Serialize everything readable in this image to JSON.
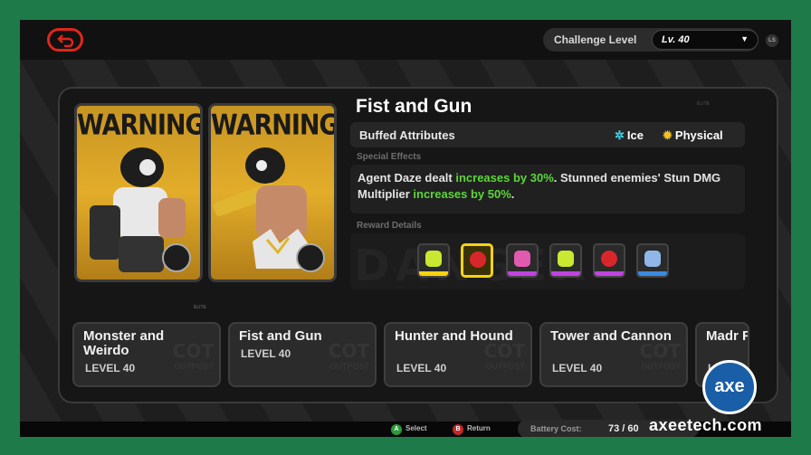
{
  "challenge": {
    "label": "Challenge Level",
    "level": "Lv. 40",
    "stick_hint": "LS"
  },
  "enemy_cards": [
    {
      "warning": "WARNING"
    },
    {
      "warning": "WARNING"
    }
  ],
  "elite_mark": "ELITE",
  "detail": {
    "title": "Fist and Gun",
    "buffed_label": "Buffed Attributes",
    "attributes": [
      {
        "name": "Ice",
        "icon": "ice-icon",
        "color": "#3fd6e8"
      },
      {
        "name": "Physical",
        "icon": "physical-icon",
        "color": "#f2c21c"
      }
    ],
    "special_label": "Special Effects",
    "special": {
      "p1": "Agent Daze dealt ",
      "h1": "increases by 30%",
      "p2": ". Stunned enemies' Stun DMG Multiplier ",
      "h2": "increases by 50%",
      "p3": "."
    },
    "reward_label": "Reward Details",
    "rewards": [
      {
        "icon": "w-engine-material-icon",
        "color": "#f5d312",
        "selected": false
      },
      {
        "icon": "drive-disc-icon",
        "color": "#f5d312",
        "selected": true
      },
      {
        "icon": "drive-disc-icon",
        "color": "#c044e0",
        "selected": false
      },
      {
        "icon": "w-engine-material-icon",
        "color": "#c044e0",
        "selected": false
      },
      {
        "icon": "drive-disc-icon",
        "color": "#c044e0",
        "selected": false
      },
      {
        "icon": "battery-material-icon",
        "color": "#3a8ae0",
        "selected": false
      }
    ]
  },
  "stages": [
    {
      "name": "Monster and Weirdo",
      "level": "LEVEL 40"
    },
    {
      "name": "Fist and Gun",
      "level": "LEVEL 40"
    },
    {
      "name": "Hunter and Hound",
      "level": "LEVEL 40"
    },
    {
      "name": "Tower and Cannon",
      "level": "LEVEL 40"
    },
    {
      "name": "Madr Fo",
      "level": "LEVEL"
    }
  ],
  "footer": {
    "select_key": "A",
    "select_label": "Select",
    "return_key": "B",
    "return_label": "Return",
    "battery_label": "Battery Cost:",
    "battery_value": "73 / 60"
  },
  "watermark": {
    "badge": "axe",
    "site": "axeetech.com"
  },
  "colors": {
    "accent_red": "#e0261c",
    "highlight_green": "#5cd63a",
    "card_gold": "#e3ad2a"
  }
}
